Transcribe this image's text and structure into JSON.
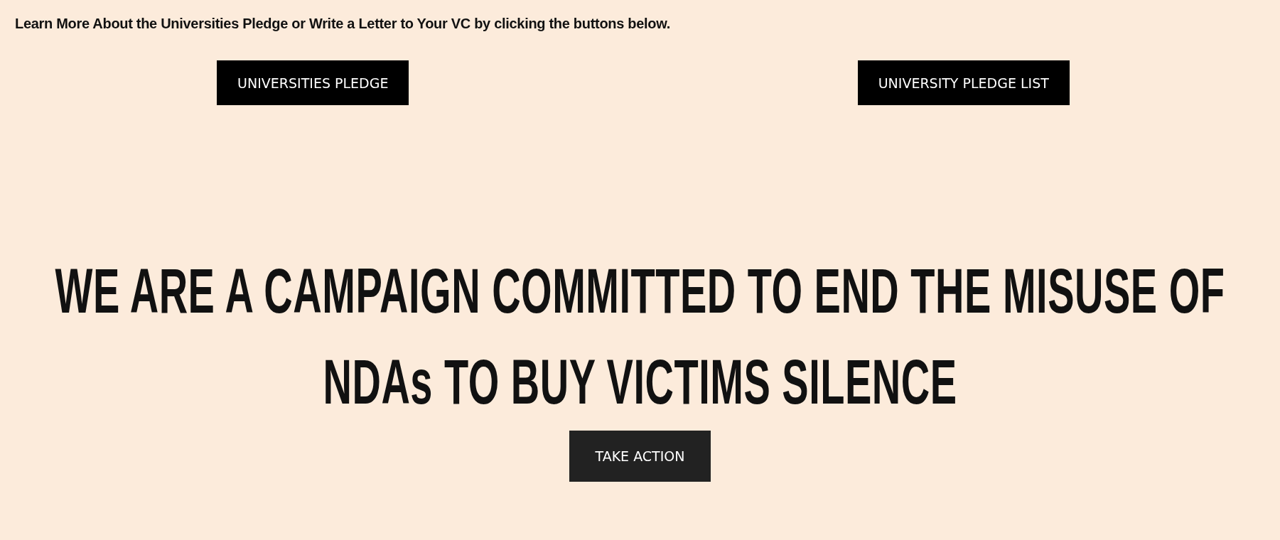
{
  "intro": "Learn More About the Universities Pledge or Write a Letter to Your VC by clicking the buttons below.",
  "buttons": [
    {
      "label": "UNIVERSITIES PLEDGE"
    },
    {
      "label": "UNIVERSITY PLEDGE LIST"
    }
  ],
  "headline": "WE ARE A CAMPAIGN COMMITTED TO END THE MISUSE OF NDAs TO BUY VICTIMS SILENCE",
  "cta": {
    "label": "TAKE ACTION"
  }
}
